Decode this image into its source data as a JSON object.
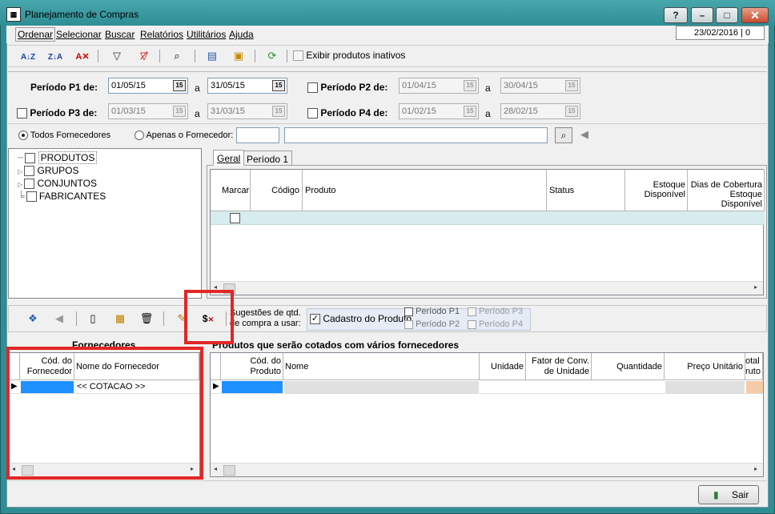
{
  "window": {
    "title": "Planejamento de Compras",
    "date_status": "23/02/2016 | 0"
  },
  "window_buttons": [
    "?",
    "–",
    "□",
    "✕"
  ],
  "menu": [
    "Ordenar",
    "Selecionar",
    "Buscar",
    "Relatórios",
    "Utilitários",
    "Ajuda"
  ],
  "toolbar": {
    "show_inactive_label": "Exibir produtos inativos"
  },
  "periods": {
    "p1": {
      "label": "Período P1 de:",
      "from": "01/05/15",
      "to": "31/05/15"
    },
    "p2": {
      "label": "Período P2 de:",
      "from": "01/04/15",
      "to": "30/04/15"
    },
    "p3": {
      "label": "Período P3 de:",
      "from": "01/03/15",
      "to": "31/03/15"
    },
    "p4": {
      "label": "Período P4 de:",
      "from": "01/02/15",
      "to": "28/02/15"
    },
    "separator": "a",
    "cal_icon_text": "15"
  },
  "supplier_filter": {
    "all_label": "Todos Fornecedores",
    "only_label": "Apenas o Fornecedor:",
    "code_value": "",
    "name_value": ""
  },
  "tree": [
    {
      "label": "PRODUTOS",
      "expandable": false
    },
    {
      "label": "GRUPOS",
      "expandable": true
    },
    {
      "label": "CONJUNTOS",
      "expandable": true
    },
    {
      "label": "FABRICANTES",
      "expandable": false
    }
  ],
  "tabs": [
    "Geral",
    "Período 1"
  ],
  "products_grid": {
    "columns": [
      "Marcar",
      "Código",
      "Produto",
      "Status",
      "Estoque Disponível",
      "Dias de Cobertura Estoque Disponível"
    ]
  },
  "suggestion": {
    "label_line1": "Sugestões de qtd.",
    "label_line2": "de compra a usar:",
    "cadastro_label": "Cadastro do Produto",
    "p1": "Período P1",
    "p2": "Período P2",
    "p3": "Período P3",
    "p4": "Período P4"
  },
  "suppliers": {
    "title": "Fornecedores",
    "columns": [
      "Cód. do Fornecedor",
      "Nome do Fornecedor"
    ],
    "rows": [
      {
        "code": "",
        "name": "<< COTACAO >>"
      }
    ]
  },
  "quoted": {
    "title": "Produtos que serão cotados com vários fornecedores",
    "columns": [
      "Cód. do Produto",
      "Nome",
      "Unidade",
      "Fator de Conv. de Unidade",
      "Quantidade",
      "Preço Unitário",
      "otal ruto"
    ]
  },
  "footer": {
    "exit_label": "Sair"
  },
  "colors": {
    "title_bar": "#2f8d95",
    "highlight_red": "#e32626",
    "selected_cell": "#1e90ff",
    "row_tint": "#d7ecee"
  }
}
